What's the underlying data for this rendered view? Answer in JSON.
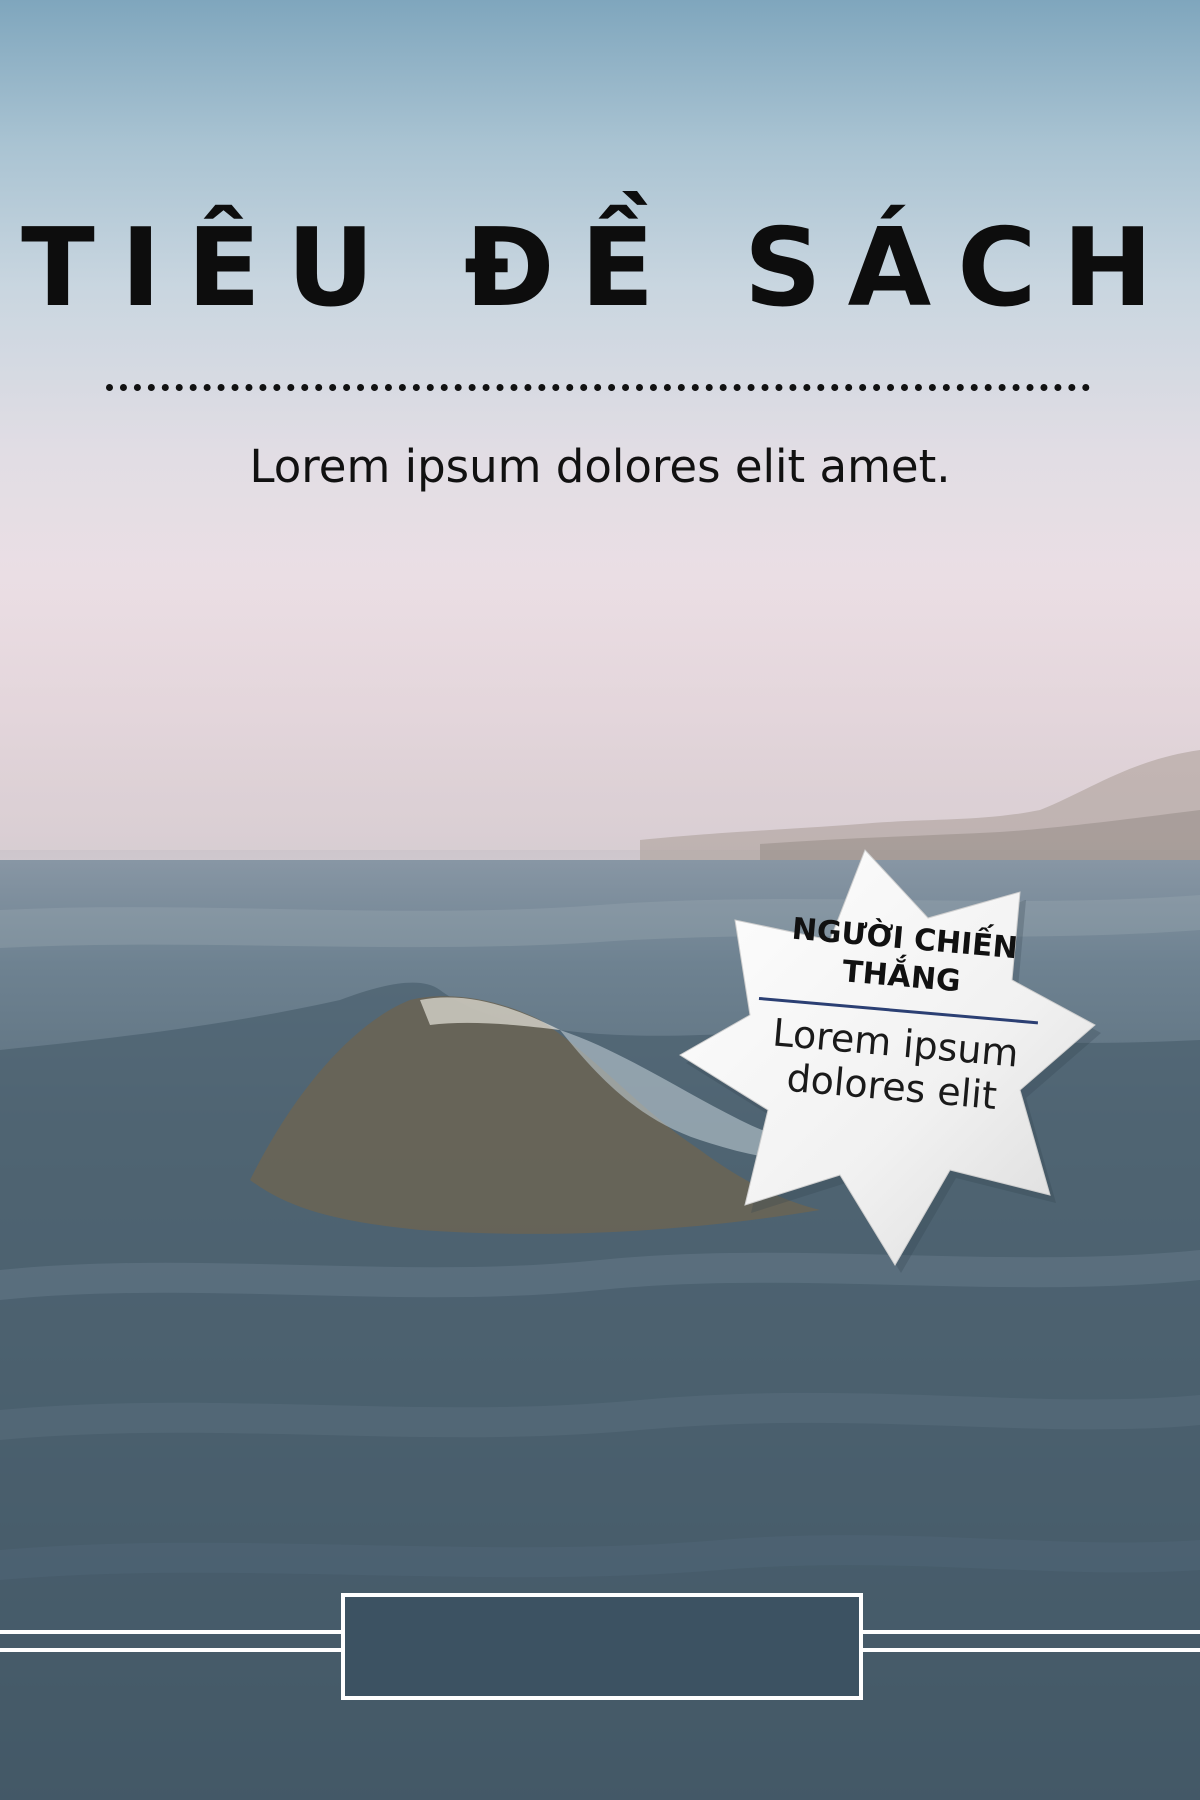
{
  "cover": {
    "title": "TIÊU ĐỀ SÁCH",
    "subtitle": "Lorem ipsum dolores elit amet."
  },
  "badge": {
    "heading": "NGƯỜI CHIẾN THẮNG",
    "body": "Lorem ipsum dolores elit"
  },
  "colors": {
    "title_text": "#0d0d0d",
    "badge_rule": "#2b3f73",
    "frame_lines": "#ffffff",
    "sea_dark": "#3f5462"
  }
}
